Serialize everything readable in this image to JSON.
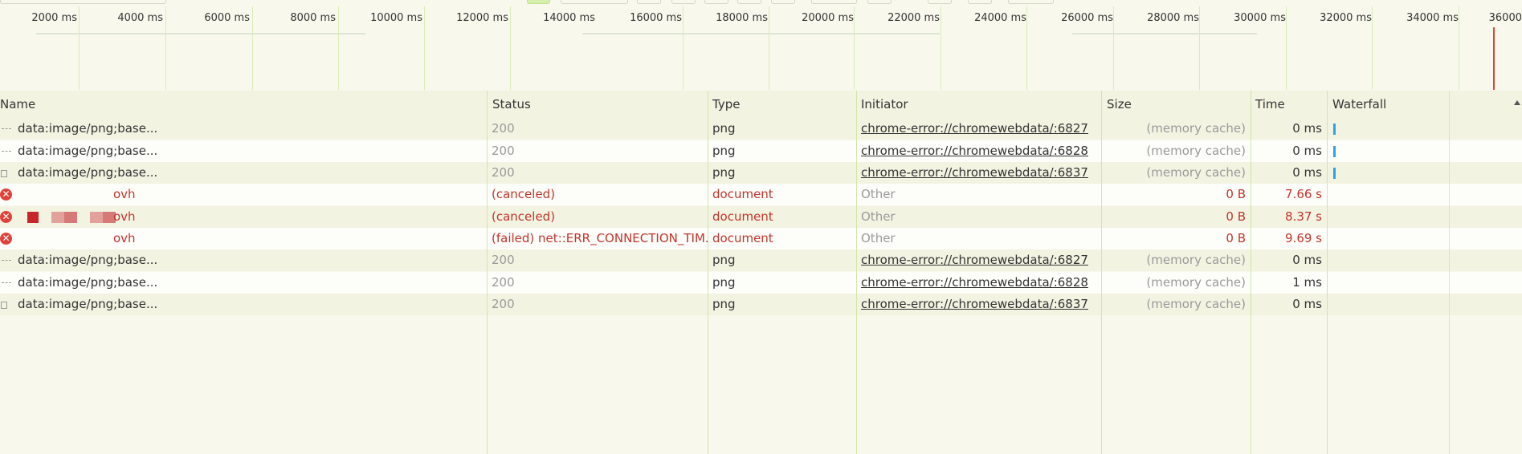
{
  "overview": {
    "ticks": [
      "2000 ms",
      "4000 ms",
      "6000 ms",
      "8000 ms",
      "10000 ms",
      "12000 ms",
      "14000 ms",
      "16000 ms",
      "18000 ms",
      "20000 ms",
      "22000 ms",
      "24000 ms",
      "26000 ms",
      "28000 ms",
      "30000 ms",
      "32000 ms",
      "34000 ms",
      "36000"
    ]
  },
  "columns": {
    "name": "Name",
    "status": "Status",
    "type": "Type",
    "initiator": "Initiator",
    "size": "Size",
    "time": "Time",
    "waterfall": "Waterfall"
  },
  "rows": [
    {
      "name": "data:image/png;base...",
      "status": "200",
      "type": "png",
      "initiator": "chrome-error://chromewebdata/:6827",
      "size": "(memory cache)",
      "time": "0 ms"
    },
    {
      "name": "data:image/png;base...",
      "status": "200",
      "type": "png",
      "initiator": "chrome-error://chromewebdata/:6828",
      "size": "(memory cache)",
      "time": "0 ms"
    },
    {
      "name": "data:image/png;base...",
      "status": "200",
      "type": "png",
      "initiator": "chrome-error://chromewebdata/:6837",
      "size": "(memory cache)",
      "time": "0 ms"
    },
    {
      "name": "ovh",
      "status": "(canceled)",
      "type": "document",
      "initiator": "Other",
      "size": "0 B",
      "time": "7.66 s"
    },
    {
      "name": "ovh",
      "status": "(canceled)",
      "type": "document",
      "initiator": "Other",
      "size": "0 B",
      "time": "8.37 s"
    },
    {
      "name": "ovh",
      "status": "(failed) net::ERR_CONNECTION_TIM...",
      "type": "document",
      "initiator": "Other",
      "size": "0 B",
      "time": "9.69 s"
    },
    {
      "name": "data:image/png;base...",
      "status": "200",
      "type": "png",
      "initiator": "chrome-error://chromewebdata/:6827",
      "size": "(memory cache)",
      "time": "0 ms"
    },
    {
      "name": "data:image/png;base...",
      "status": "200",
      "type": "png",
      "initiator": "chrome-error://chromewebdata/:6828",
      "size": "(memory cache)",
      "time": "1 ms"
    },
    {
      "name": "data:image/png;base...",
      "status": "200",
      "type": "png",
      "initiator": "chrome-error://chromewebdata/:6837",
      "size": "(memory cache)",
      "time": "0 ms"
    }
  ],
  "colors": {
    "error": "#c0352c",
    "accent_bar": "#2aa4e6",
    "grid": "#cfe7a9"
  }
}
